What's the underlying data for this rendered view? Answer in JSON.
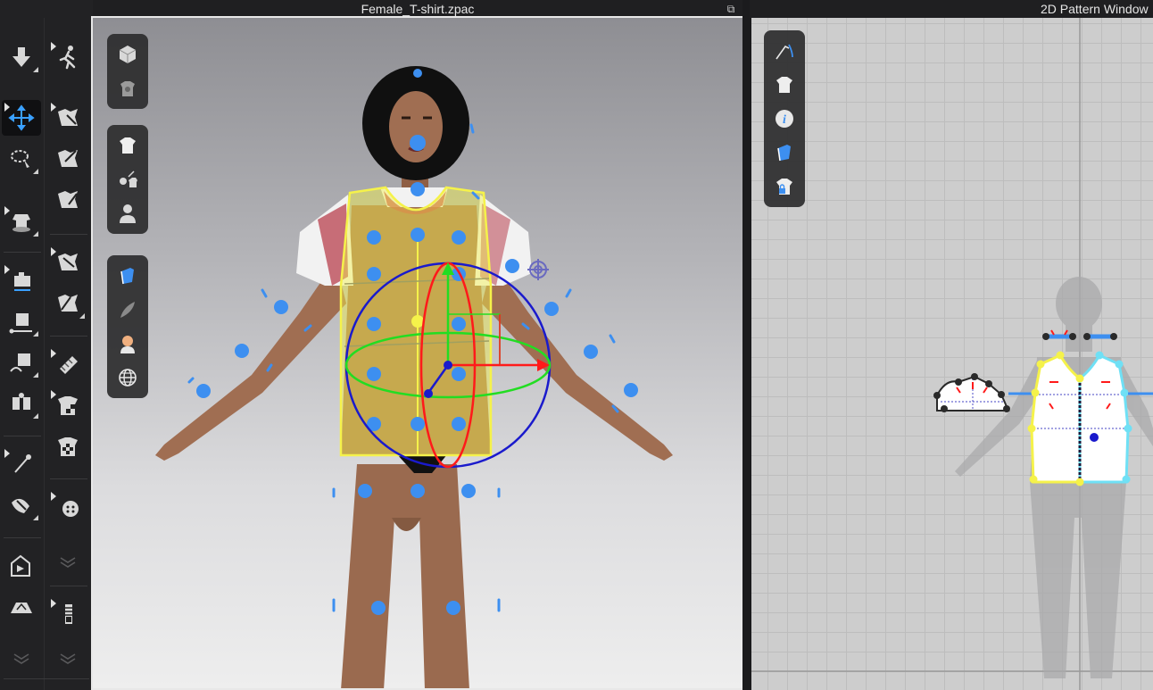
{
  "windows": {
    "viewport_3d_title": "Female_T-shirt.zpac",
    "pattern_2d_title": "2D Pattern Window"
  },
  "left_toolbar": {
    "col1": [
      "simulation-icon",
      "transform-gizmo-icon",
      "lasso-select-icon",
      "avatar-measure-icon",
      "sewing-tool-icon",
      "edit-sewing-icon",
      "segment-sewing-icon",
      "free-sewing-icon",
      "pin-icon",
      "tack-icon",
      "fold-icon",
      "trim-icon",
      "expand-icon"
    ],
    "col2": [
      "animation-icon",
      "select-move-icon",
      "transform-pattern-icon",
      "edit-pattern-icon",
      "pleat-icon",
      "fold-arrange-icon",
      "texture-icon",
      "checker-icon",
      "checker-shirt-icon",
      "button-icon",
      "expand-icon",
      "zipper-icon",
      "expand-icon"
    ]
  },
  "viewport_3d": {
    "toolbar_groups": [
      [
        "render-cube-icon",
        "shirt-texture-icon"
      ],
      [
        "garment-icon",
        "pin-settings-icon",
        "avatar-icon"
      ],
      [
        "fabric-icon",
        "shading-icon",
        "skin-icon",
        "globe-icon"
      ]
    ],
    "colors": {
      "selection": "#f5f24a",
      "arrangement_points": "#3d8ff0",
      "gizmo_x": "#ff1a1a",
      "gizmo_y": "#22dd22",
      "gizmo_z": "#1a1acc"
    }
  },
  "pattern_2d": {
    "toolbar": [
      "line-edit-icon",
      "garment-shirt-icon",
      "info-icon",
      "fabric-blue-icon",
      "lock-shirt-icon"
    ],
    "colors": {
      "selected_outline": "#f5f24a",
      "linked_outline": "#6fe0f5",
      "grid": "#bdbdbd"
    }
  }
}
